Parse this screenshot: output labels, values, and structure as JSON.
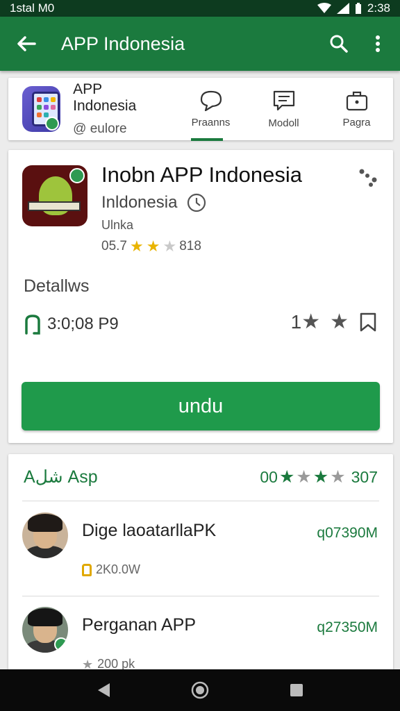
{
  "status_bar": {
    "left_text": "1stal M0",
    "time": "2:38"
  },
  "app_bar": {
    "title": "APP Indonesia",
    "back_icon": "arrow-left-icon",
    "search_icon": "search-icon",
    "more_icon": "more-vert-icon"
  },
  "header": {
    "app_name": "APP Indonesia",
    "app_sub": "@ eulore",
    "tabs": [
      {
        "label": "Praanns",
        "icon": "chat-bubble-icon",
        "active": true
      },
      {
        "label": "Modoll",
        "icon": "message-icon",
        "active": false
      },
      {
        "label": "Pagra",
        "icon": "briefcase-icon",
        "active": false
      }
    ]
  },
  "app_detail": {
    "title": "Inobn APP Indonesia",
    "developer": "Inldonesia",
    "category": "Ulnka",
    "rating_value": "05.7",
    "rating_count": "818",
    "rating_stars": 2,
    "rating_max": 3,
    "details_label": "Detallws",
    "size_text": "3:0;08 P9",
    "right_rating_text": "1",
    "install_label": "undu",
    "accent_color": "#1f9a4b"
  },
  "list": {
    "title": "Aشل Asp",
    "rating_prefix": "00",
    "rating_count": "307",
    "items": [
      {
        "name": "Dige laoatarllaPK",
        "size": "q07390M",
        "meta": "2K0.0W"
      },
      {
        "name": "Perganan APP",
        "size": "q27350M",
        "meta": "200 pk"
      }
    ]
  }
}
